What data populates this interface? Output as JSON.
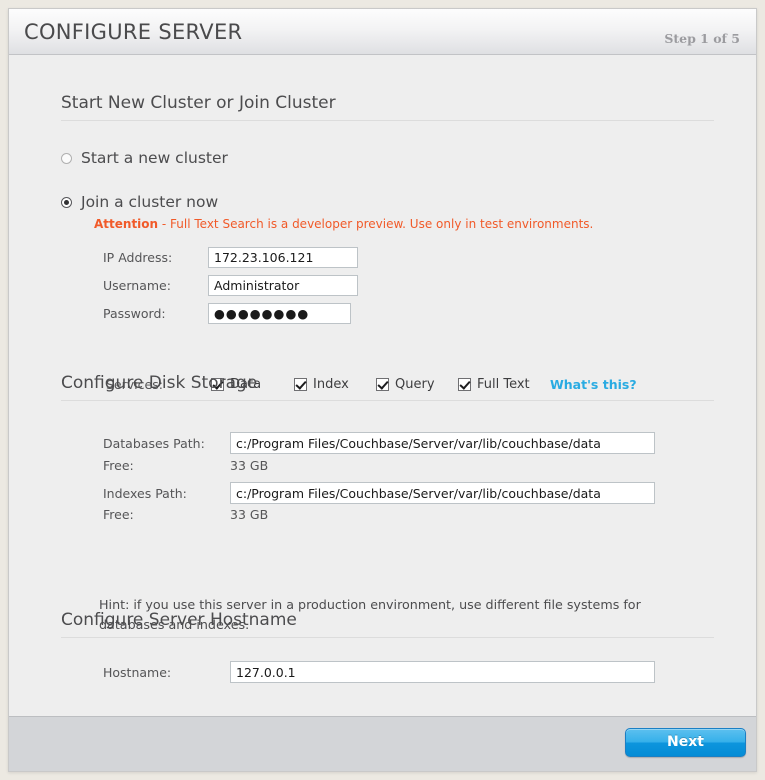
{
  "header": {
    "title": "CONFIGURE SERVER",
    "step": "Step 1 of 5"
  },
  "cluster_section": {
    "title": "Start New Cluster or Join Cluster",
    "options": [
      {
        "label": "Start a new cluster",
        "selected": false
      },
      {
        "label": "Join a cluster now",
        "selected": true
      }
    ],
    "attention_prefix": "Attention",
    "attention_text": " - Full Text Search is a developer preview. Use only in test environments.",
    "attention_color": "#f15a29",
    "fields": [
      {
        "label": "IP Address:",
        "value": "172.23.106.121"
      },
      {
        "label": "Username:",
        "value": "Administrator"
      },
      {
        "label": "Password:",
        "value": "●●●●●●●●"
      }
    ],
    "services_label": "Services:",
    "services": [
      {
        "name": "Data",
        "checked": true
      },
      {
        "name": "Index",
        "checked": true
      },
      {
        "name": "Query",
        "checked": true
      },
      {
        "name": "Full Text",
        "checked": true
      }
    ],
    "help_link": "What's this?",
    "help_link_color": "#29abe2"
  },
  "disk_section": {
    "title": "Configure Disk Storage",
    "databases_path_label": "Databases Path:",
    "databases_path_value": "c:/Program Files/Couchbase/Server/var/lib/couchbase/data",
    "databases_free_label": "Free:",
    "databases_free_value": "33 GB",
    "indexes_path_label": "Indexes Path:",
    "indexes_path_value": "c:/Program Files/Couchbase/Server/var/lib/couchbase/data",
    "indexes_free_label": "Free:",
    "indexes_free_value": "33 GB",
    "hint": "Hint: if you use this server in a production environment, use different file systems for databases and indexes."
  },
  "hostname_section": {
    "title": "Configure Server Hostname",
    "hostname_label": "Hostname:",
    "hostname_value": "127.0.0.1"
  },
  "footer": {
    "next_label": "Next"
  }
}
